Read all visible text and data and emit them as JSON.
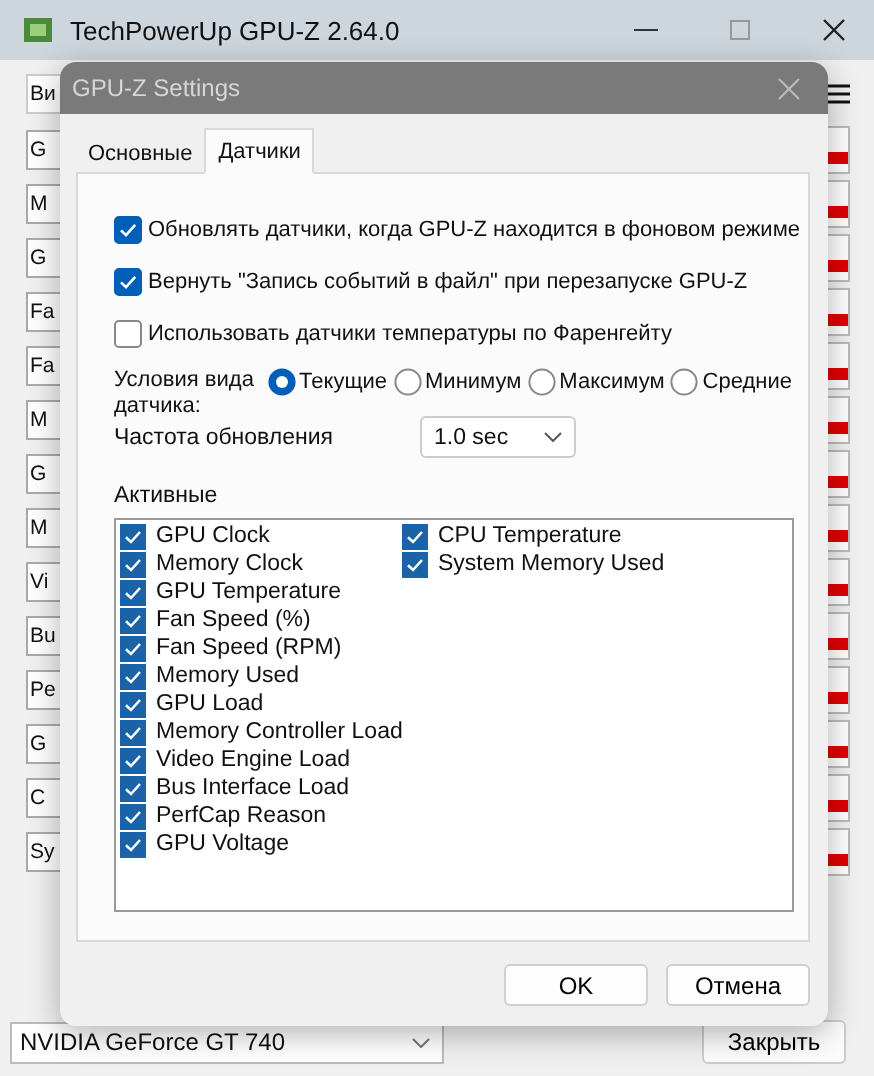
{
  "window": {
    "title": "TechPowerUp GPU-Z 2.64.0"
  },
  "main_tab": {
    "label": "Ви"
  },
  "sensor_rows": [
    {
      "label": "G"
    },
    {
      "label": "M"
    },
    {
      "label": "G"
    },
    {
      "label": "Fa"
    },
    {
      "label": "Fa"
    },
    {
      "label": "M"
    },
    {
      "label": "G"
    },
    {
      "label": "M"
    },
    {
      "label": "Vi"
    },
    {
      "label": "Bu"
    },
    {
      "label": "Pe"
    },
    {
      "label": "G"
    },
    {
      "label": "C"
    },
    {
      "label": "Sy"
    }
  ],
  "gpu_select": {
    "value": "NVIDIA GeForce GT 740"
  },
  "close_button": {
    "label": "Закрыть"
  },
  "dialog": {
    "title": "GPU-Z Settings",
    "tabs": [
      {
        "label": "Основные",
        "selected": false
      },
      {
        "label": "Датчики",
        "selected": true
      }
    ],
    "options": [
      {
        "label": "Обновлять датчики, когда GPU-Z находится в фоновом режиме",
        "checked": true
      },
      {
        "label": "Вернуть \"Запись событий в файл\" при перезапуске GPU-Z",
        "checked": true
      },
      {
        "label": "Использовать датчики температуры по Фаренгейту",
        "checked": false
      }
    ],
    "view_mode": {
      "label": "Условия вида датчика:",
      "options": [
        {
          "label": "Текущие",
          "selected": true
        },
        {
          "label": "Минимум",
          "selected": false
        },
        {
          "label": "Максимум",
          "selected": false
        },
        {
          "label": "Средние",
          "selected": false
        }
      ]
    },
    "refresh": {
      "label": "Частота обновления",
      "value": "1.0 sec"
    },
    "active": {
      "label": "Активные",
      "sensors": [
        {
          "label": "GPU Clock",
          "checked": true
        },
        {
          "label": "Memory Clock",
          "checked": true
        },
        {
          "label": "GPU Temperature",
          "checked": true
        },
        {
          "label": "Fan Speed (%)",
          "checked": true
        },
        {
          "label": "Fan Speed (RPM)",
          "checked": true
        },
        {
          "label": "Memory Used",
          "checked": true
        },
        {
          "label": "GPU Load",
          "checked": true
        },
        {
          "label": "Memory Controller Load",
          "checked": true
        },
        {
          "label": "Video Engine Load",
          "checked": true
        },
        {
          "label": "Bus Interface Load",
          "checked": true
        },
        {
          "label": "PerfCap Reason",
          "checked": true
        },
        {
          "label": "GPU Voltage",
          "checked": true
        },
        {
          "label": "CPU Temperature",
          "checked": true
        },
        {
          "label": "System Memory Used",
          "checked": true
        }
      ]
    },
    "buttons": [
      {
        "label": "OK"
      },
      {
        "label": "Отмена"
      }
    ]
  }
}
